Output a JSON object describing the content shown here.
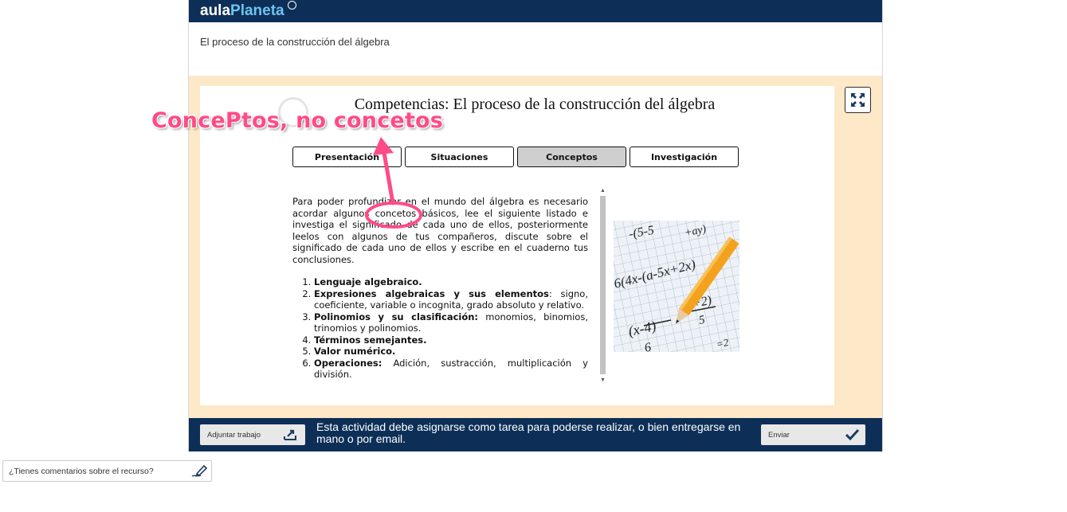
{
  "header": {
    "logo_part1": "aula",
    "logo_part2": "Planeta",
    "subtitle": "El proceso de la construcción del álgebra"
  },
  "activity": {
    "title": "Competencias: El proceso de la construcción del álgebra",
    "tabs": [
      {
        "label": "Presentación",
        "active": false
      },
      {
        "label": "Situaciones",
        "active": false
      },
      {
        "label": "Conceptos",
        "active": true
      },
      {
        "label": "Investigación",
        "active": false
      }
    ],
    "intro": "Para poder profundizar en el mundo del álgebra es necesario acordar algunos concetos básicos, lee el siguiente listado e investiga el significado de cada uno de ellos, posteriormente leelos con algunos de tus compañeros, discute sobre el significado de cada uno de ellos y escribe en el cuaderno tus conclusiones.",
    "list": [
      {
        "bold": "Lenguaje algebraico.",
        "rest": ""
      },
      {
        "bold": "Expresiones algebraicas y sus elementos",
        "rest": ": signo, coeficiente, variable o incognita, grado absoluto y relativo."
      },
      {
        "bold": "Polinomios y su clasificación:",
        "rest": " monomios, binomios, trinomios y polinomios."
      },
      {
        "bold": "Términos semejantes.",
        "rest": ""
      },
      {
        "bold": "Valor numérico.",
        "rest": ""
      },
      {
        "bold": "Operaciones:",
        "rest": " Adición, sustracción, multiplicación y división."
      }
    ],
    "image_icon": "math-equations-pencil-image"
  },
  "bottom": {
    "attach_label": "Adjuntar trabajo",
    "message": "Esta actividad debe asignarse como tarea para poderse realizar, o bien entregarse en mano o por email.",
    "send_label": "Enviar"
  },
  "feedback": {
    "label": "¿Tienes comentarios sobre el recurso?"
  },
  "annotation": {
    "text": "ConcePtos, no concetos",
    "color": "#ff4b86"
  },
  "colors": {
    "brand_navy": "#0d2f57",
    "activity_bg": "#fde9c7"
  }
}
